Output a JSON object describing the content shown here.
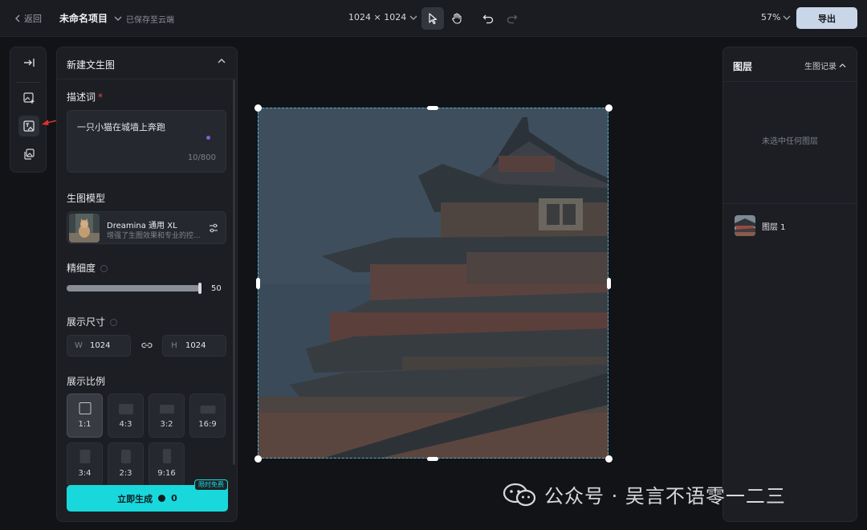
{
  "topbar": {
    "back_label": "返回",
    "project_name": "未命名项目",
    "save_status": "已保存至云端",
    "canvas_size": "1024 × 1024",
    "zoom": "57%",
    "export_label": "导出"
  },
  "generate_panel": {
    "title": "新建文生图",
    "prompt_label": "描述词",
    "required_mark": "*",
    "prompt_value": "一只小猫在城墙上奔跑",
    "prompt_count": "10/800",
    "model_label": "生图模型",
    "model_name": "Dreamina 通用 XL",
    "model_desc": "增强了生图效果和专业的控...",
    "detail_label": "精细度",
    "detail_value": "50",
    "detail_fraction": 0.98,
    "size_label": "展示尺寸",
    "width_letter": "W",
    "width_value": "1024",
    "height_letter": "H",
    "height_value": "1024",
    "ratio_label": "展示比例",
    "ratios": [
      "1:1",
      "4:3",
      "3:2",
      "16:9",
      "3:4",
      "2:3",
      "9:16"
    ],
    "selected_ratio": "1:1",
    "generate_label": "立即生成",
    "generate_cost": "0",
    "badge": "限时免费",
    "accent_color": "#18d8dc"
  },
  "layers_panel": {
    "title": "图层",
    "history_label": "生图记录",
    "empty_message": "未选中任何图层",
    "layers": [
      {
        "name": "图层 1"
      }
    ]
  },
  "watermark": {
    "text": "公众号 · 吴言不语零一二三"
  }
}
